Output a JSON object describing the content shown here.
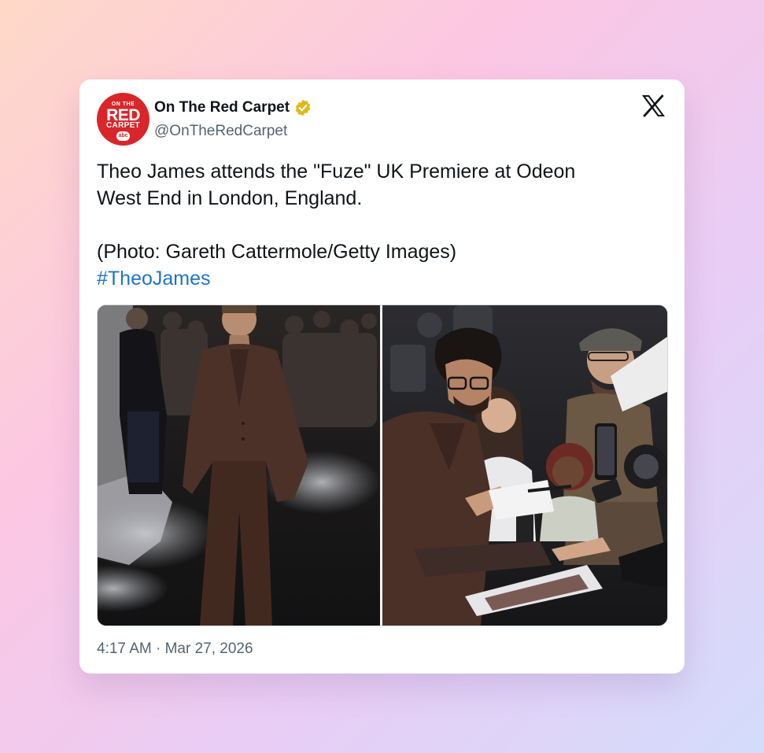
{
  "tweet": {
    "avatar": {
      "line1": "ON THE",
      "line2": "RED",
      "line3": "CARPET",
      "badge": "abc",
      "icon": "on-the-red-carpet-logo"
    },
    "display_name": "On The Red Carpet",
    "verified_icon": "verified-badge-icon",
    "handle": "@OnTheRedCarpet",
    "platform_icon": "x-logo-icon",
    "text_line1": "Theo James attends the \"Fuze\" UK Premiere at Odeon",
    "text_line2": "West End in London, England.",
    "credit": "(Photo: Gareth Cattermole/Getty Images)",
    "hashtag": "#TheoJames",
    "photos": [
      {
        "name": "photo-red-carpet-pose"
      },
      {
        "name": "photo-signing-autographs"
      }
    ],
    "timestamp": "4:17 AM · Mar 27, 2026"
  },
  "colors": {
    "link": "#1d74c9",
    "muted_text": "#536471",
    "primary_text": "#0f1419",
    "brand_red": "#d8262b",
    "verified_gold": "#e2b719"
  }
}
